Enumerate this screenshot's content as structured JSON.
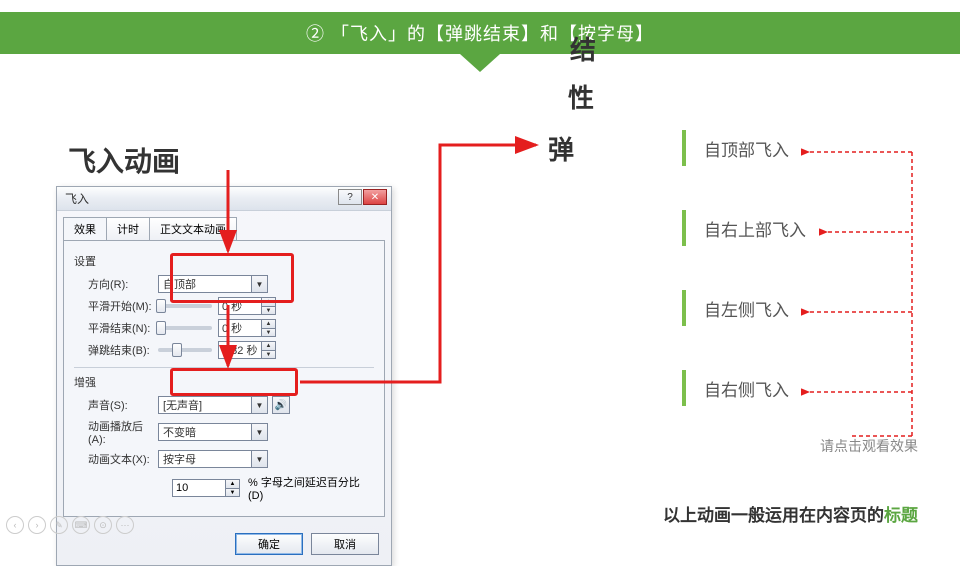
{
  "header": {
    "text": "② 「飞入」的【弹跳结束】和【按字母】"
  },
  "section_title": "飞入动画",
  "bounce": {
    "c1": "结",
    "c2": "性",
    "c3": "弹"
  },
  "dialog": {
    "title": "飞入",
    "tabs": {
      "t1": "效果",
      "t2": "计时",
      "t3": "正文文本动画"
    },
    "group_settings": "设置",
    "direction_label": "方向(R):",
    "direction_value": "自顶部",
    "smooth_start_label": "平滑开始(M):",
    "smooth_start_value": "0 秒",
    "smooth_end_label": "平滑结束(N):",
    "smooth_end_value": "0 秒",
    "bounce_end_label": "弹跳结束(B):",
    "bounce_end_value": "0.32 秒",
    "group_enhance": "增强",
    "sound_label": "声音(S):",
    "sound_value": "[无声音]",
    "after_label": "动画播放后(A):",
    "after_value": "不变暗",
    "text_anim_label": "动画文本(X):",
    "text_anim_value": "按字母",
    "delay_value": "10",
    "delay_label": "% 字母之间延迟百分比(D)",
    "ok": "确定",
    "cancel": "取消"
  },
  "effects": {
    "e1": "自顶部飞入",
    "e2": "自右上部飞入",
    "e3": "自左侧飞入",
    "e4": "自右侧飞入"
  },
  "note": "请点击观看效果",
  "caption_a": "以上动画一般运用在内容页的",
  "caption_b": "标题"
}
